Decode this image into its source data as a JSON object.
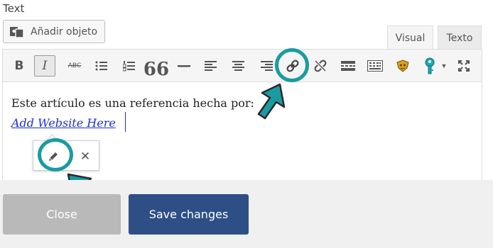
{
  "field": {
    "label": "Text"
  },
  "media": {
    "button_label": "Añadir objeto",
    "icon": "add-media-icon"
  },
  "tabs": [
    {
      "label": "Visual",
      "active": true
    },
    {
      "label": "Texto",
      "active": false
    }
  ],
  "toolbar": {
    "bold_label": "B",
    "italic_label": "I",
    "strike_label": "ABC",
    "quote_label": "66",
    "buttons": [
      "bold-icon",
      "italic-icon",
      "strikethrough-icon",
      "bulleted-list-icon",
      "numbered-list-icon",
      "blockquote-icon",
      "horizontal-line-icon",
      "align-left-icon",
      "align-center-icon",
      "align-right-icon",
      "link-icon",
      "unlink-icon",
      "read-more-icon",
      "toolbar-toggle-icon",
      "plugin-shield-icon",
      "plugin-key-icon",
      "dropdown-icon",
      "fullscreen-icon"
    ],
    "active_button": "italic-icon",
    "highlighted_button": "link-icon"
  },
  "editor": {
    "paragraph": "Este artículo es una referencia hecha por:",
    "link_text": "Add Website Here"
  },
  "link_popover": {
    "edit_icon": "pencil-icon",
    "remove_label": "✕"
  },
  "footer": {
    "close_label": "Close",
    "save_label": "Save changes"
  },
  "colors": {
    "highlight": "#1a9ba1",
    "link": "#1f31c8",
    "save_button": "#2d4f85",
    "close_button": "#b9b9b9",
    "footer_bg": "#f0f0f0"
  }
}
